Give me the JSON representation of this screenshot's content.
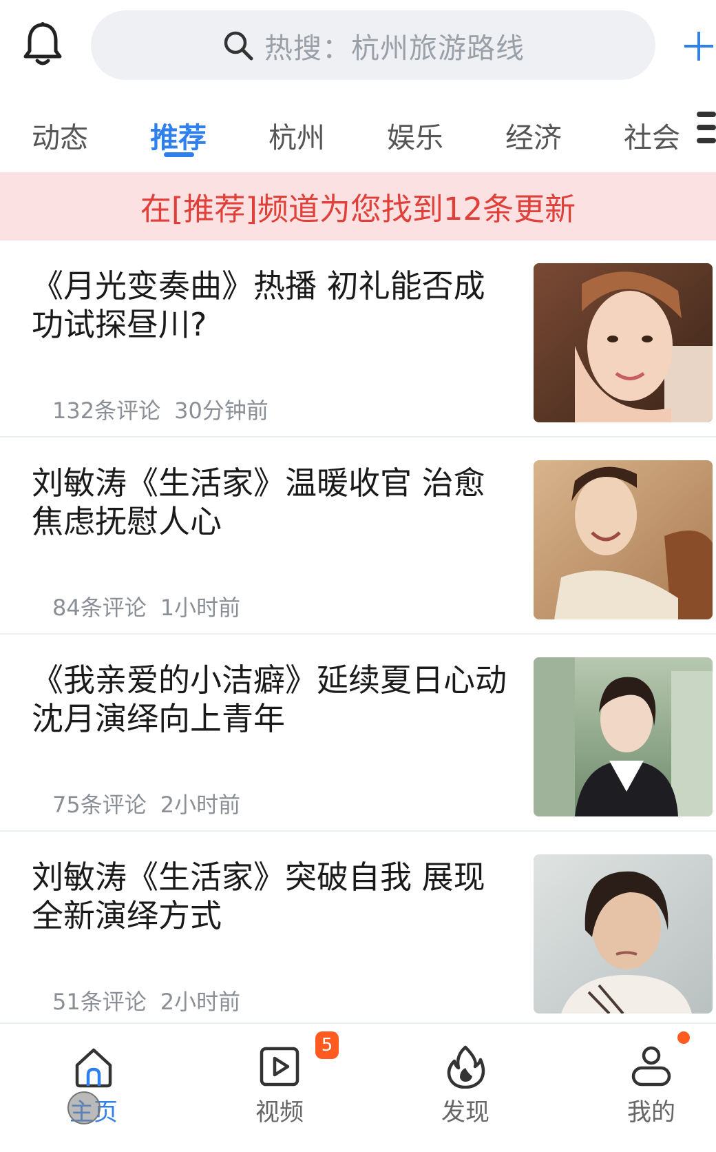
{
  "header": {
    "search_placeholder": "热搜：杭州旅游路线",
    "icons": {
      "bell": "bell-icon",
      "search": "search-icon",
      "add": "plus-icon"
    },
    "accent_color": "#2f80ed"
  },
  "tabs": [
    {
      "label": "动态",
      "active": false
    },
    {
      "label": "推荐",
      "active": true
    },
    {
      "label": "杭州",
      "active": false
    },
    {
      "label": "娱乐",
      "active": false
    },
    {
      "label": "经济",
      "active": false
    },
    {
      "label": "社会",
      "active": false
    }
  ],
  "banner": {
    "text": "在[推荐]频道为您找到12条更新",
    "color": "#e0403a"
  },
  "feed": [
    {
      "title": "《月光变奏曲》热播 初礼能否成功试探昼川?",
      "comments": "132条评论",
      "time": "30分钟前",
      "thumb": "portrait-woman-smiling"
    },
    {
      "title": "刘敏涛《生活家》温暖收官 治愈焦虑抚慰人心",
      "comments": "84条评论",
      "time": "1小时前",
      "thumb": "portrait-woman-laughing"
    },
    {
      "title": "《我亲爱的小洁癖》延续夏日心动 沈月演绎向上青年",
      "comments": "75条评论",
      "time": "2小时前",
      "thumb": "portrait-woman-outdoors"
    },
    {
      "title": "刘敏涛《生活家》突破自我 展现全新演绎方式",
      "comments": "51条评论",
      "time": "2小时前",
      "thumb": "portrait-woman-serious"
    }
  ],
  "bottom_nav": [
    {
      "label": "主页",
      "icon": "home-icon",
      "active": true
    },
    {
      "label": "视频",
      "icon": "video-icon",
      "active": false,
      "badge": "5"
    },
    {
      "label": "发现",
      "icon": "flame-icon",
      "active": false
    },
    {
      "label": "我的",
      "icon": "user-icon",
      "active": false,
      "dot": true
    }
  ]
}
